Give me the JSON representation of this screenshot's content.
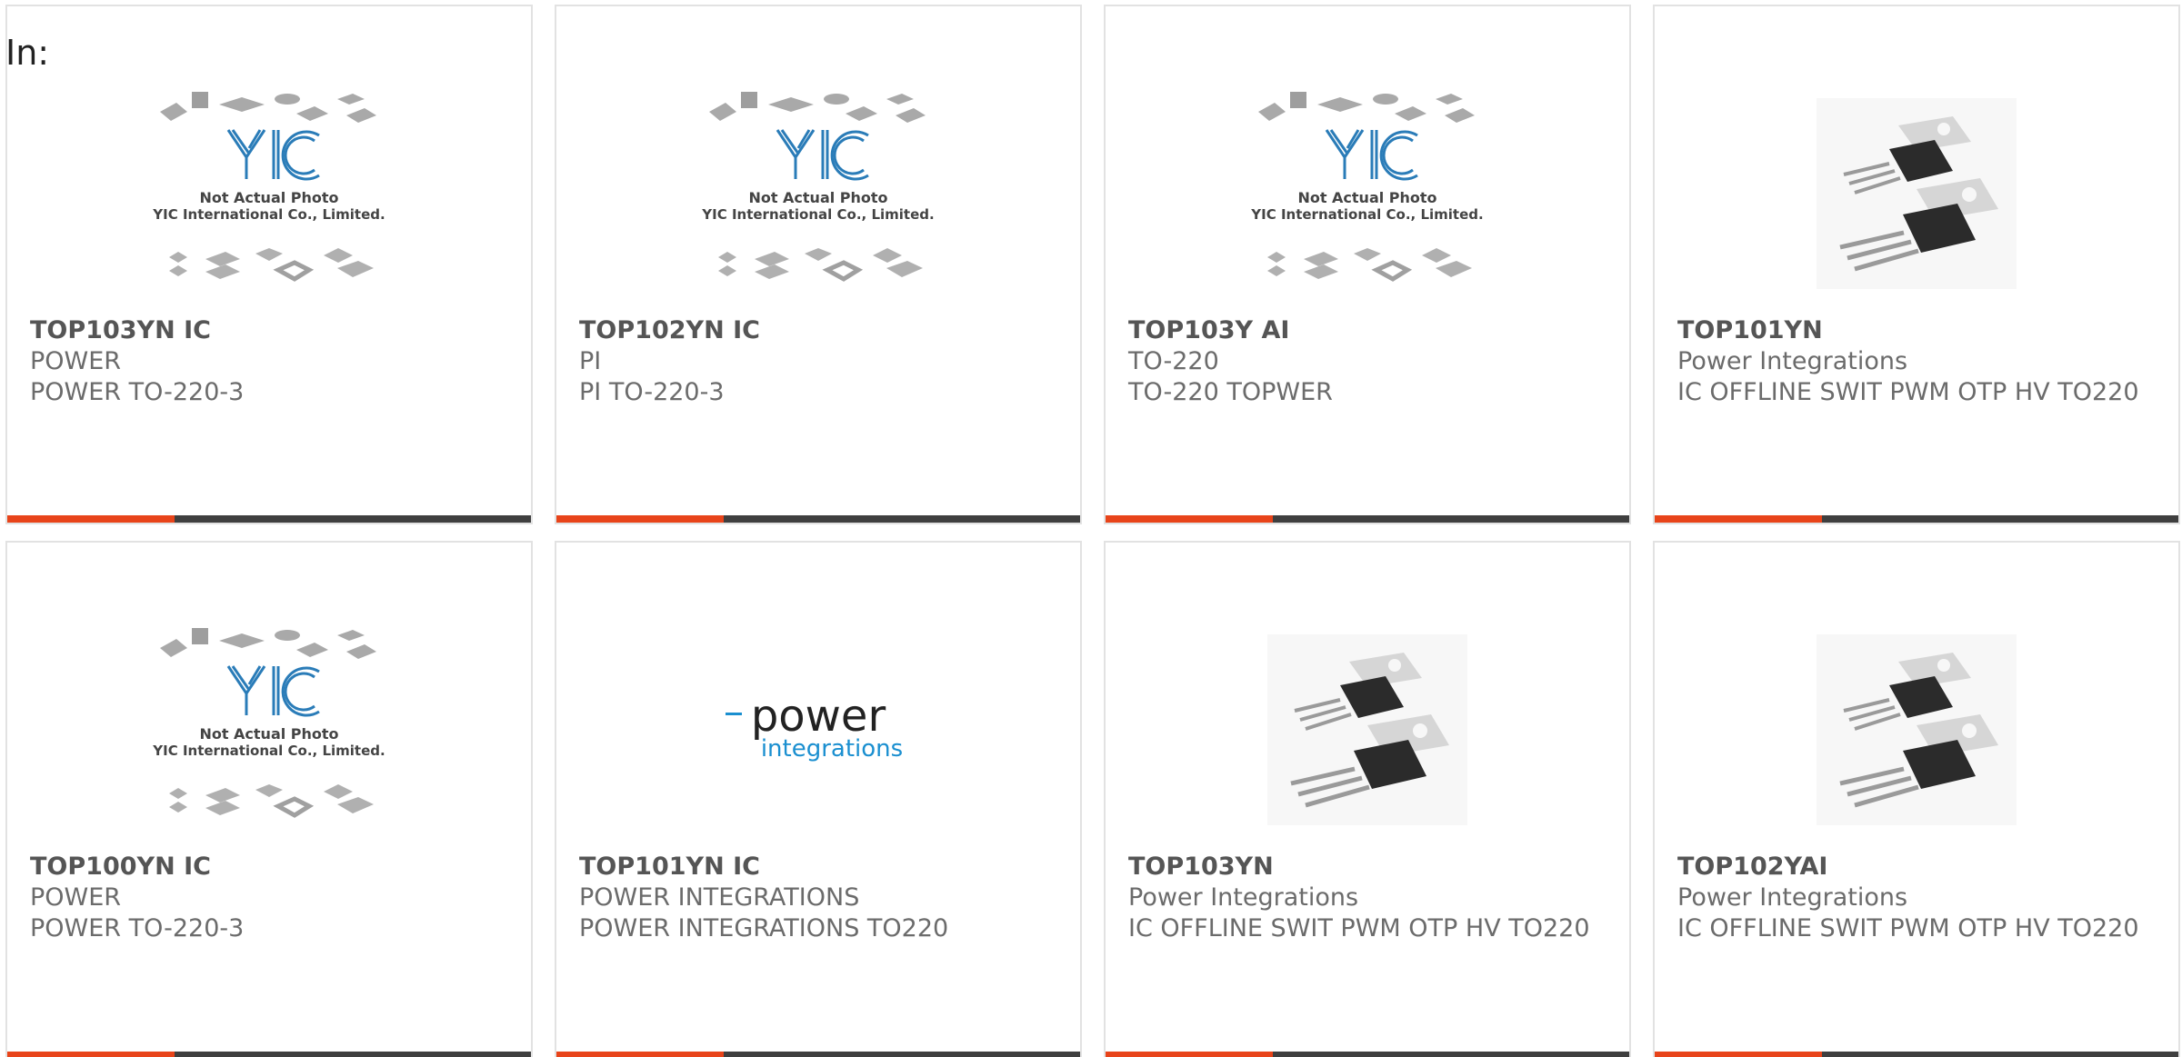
{
  "page": {
    "in_label": "In:"
  },
  "colors": {
    "accent": "#e8441a",
    "bar": "#3f3f3f",
    "border": "#e2e2e2"
  },
  "products": [
    {
      "part": "TOP103YN IC",
      "mfr": "POWER",
      "desc": "POWER TO-220-3",
      "image": "yic-placeholder",
      "caption1": "Not Actual Photo",
      "caption2": "YIC International Co., Limited."
    },
    {
      "part": "TOP102YN IC",
      "mfr": "PI",
      "desc": "PI TO-220-3",
      "image": "yic-placeholder",
      "caption1": "Not Actual Photo",
      "caption2": "YIC International Co., Limited."
    },
    {
      "part": "TOP103Y AI",
      "mfr": "TO-220",
      "desc": "TO-220 TOPWER",
      "image": "yic-placeholder",
      "caption1": "Not Actual Photo",
      "caption2": "YIC International Co., Limited."
    },
    {
      "part": "TOP101YN",
      "mfr": "Power Integrations",
      "desc": "IC OFFLINE SWIT PWM OTP HV TO220",
      "image": "to220-photo"
    },
    {
      "part": "TOP100YN IC",
      "mfr": "POWER",
      "desc": "POWER TO-220-3",
      "image": "yic-placeholder",
      "caption1": "Not Actual Photo",
      "caption2": "YIC International Co., Limited."
    },
    {
      "part": "TOP101YN IC",
      "mfr": "POWER INTEGRATIONS",
      "desc": "POWER INTEGRATIONS TO220",
      "image": "power-integrations-logo",
      "logo1": "power",
      "logo2": "integrations"
    },
    {
      "part": "TOP103YN",
      "mfr": "Power Integrations",
      "desc": "IC OFFLINE SWIT PWM OTP HV TO220",
      "image": "to220-photo"
    },
    {
      "part": "TOP102YAI",
      "mfr": "Power Integrations",
      "desc": "IC OFFLINE SWIT PWM OTP HV TO220",
      "image": "to220-photo"
    }
  ]
}
